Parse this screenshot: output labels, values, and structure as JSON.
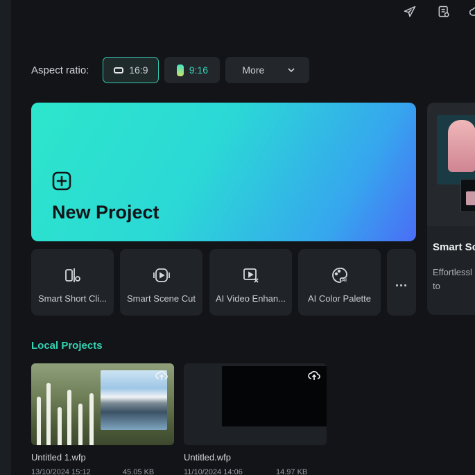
{
  "aspect": {
    "label": "Aspect ratio:",
    "options": [
      {
        "label": "16:9",
        "selected": true
      },
      {
        "label": "9:16",
        "selected": false
      }
    ],
    "more_label": "More"
  },
  "new_project": {
    "label": "New Project"
  },
  "feature_card": {
    "title": "Smart Sc",
    "description": "Effortlessl scenes to"
  },
  "tools": [
    {
      "label": "Smart Short Cli...",
      "icon": "smart-short-clips-icon"
    },
    {
      "label": "Smart Scene Cut",
      "icon": "scene-cut-icon"
    },
    {
      "label": "AI Video Enhan...",
      "icon": "video-enhance-icon"
    },
    {
      "label": "AI Color Palette",
      "icon": "palette-ai-icon"
    }
  ],
  "tools_more": "...",
  "local_projects": {
    "title": "Local Projects",
    "items": [
      {
        "name": "Untitled 1.wfp",
        "date": "13/10/2024 15:12",
        "size": "45.05 KB"
      },
      {
        "name": "Untitled.wfp",
        "date": "11/10/2024 14:06",
        "size": "14.97 KB"
      }
    ]
  },
  "colors": {
    "accent": "#35d3b4",
    "background": "#121417",
    "card": "#202328"
  }
}
